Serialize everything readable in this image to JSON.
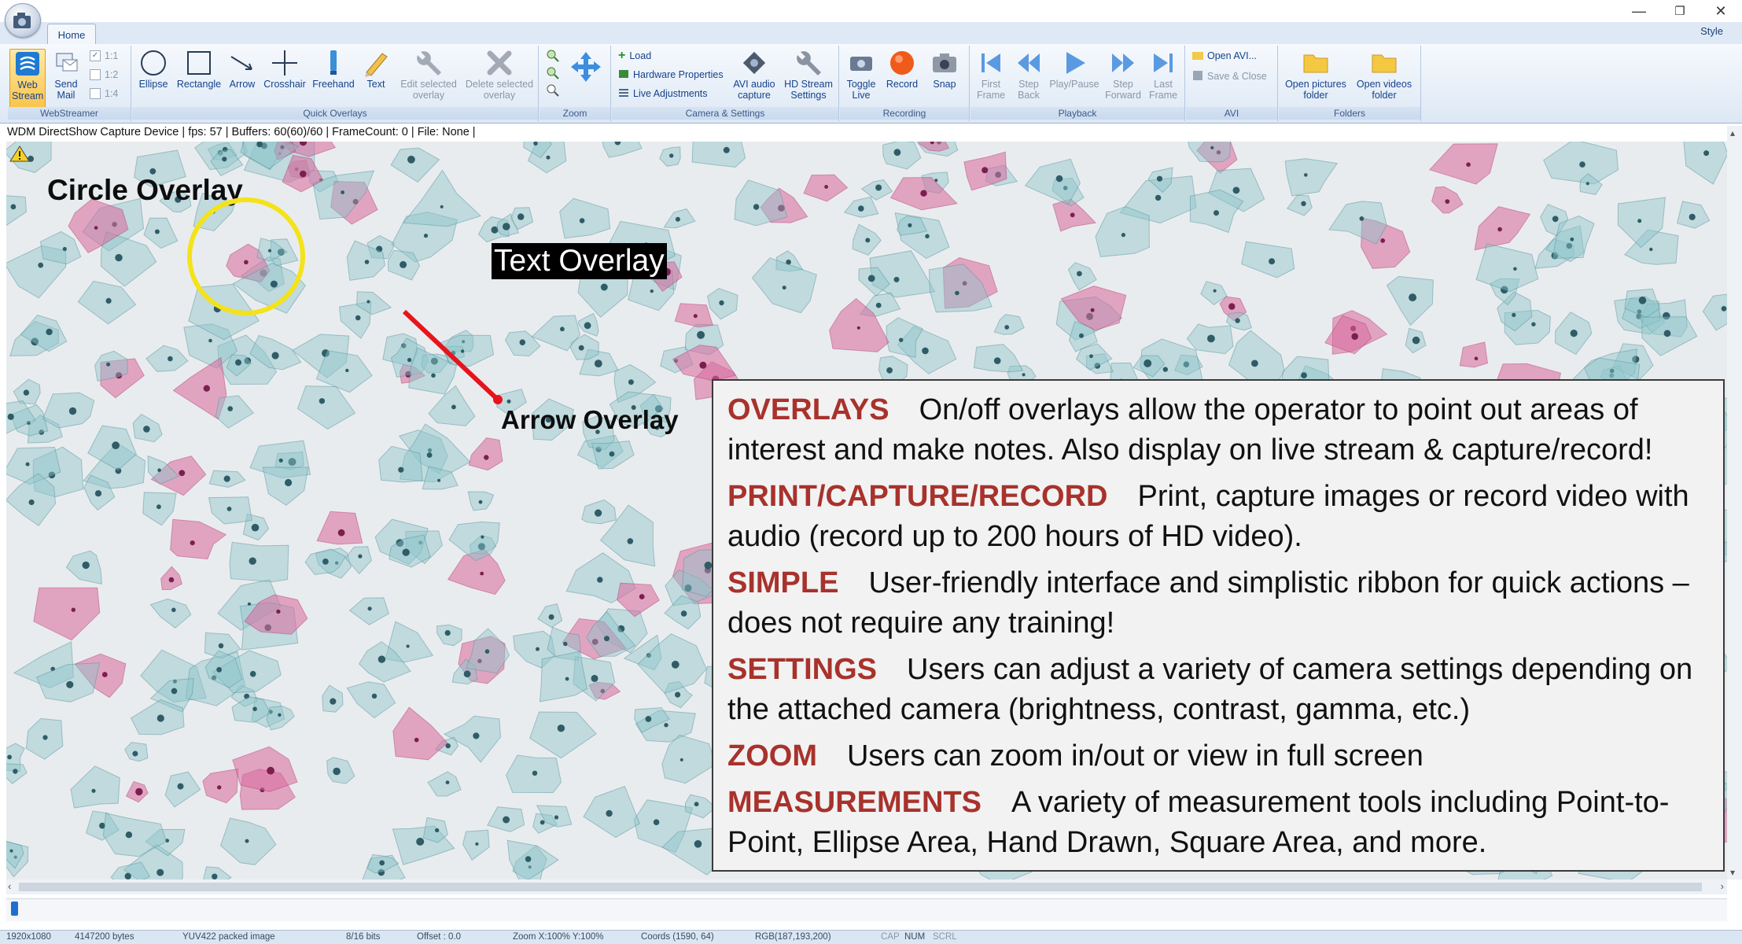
{
  "window": {
    "style_label": "Style",
    "controls": [
      "—",
      "❐",
      "✕"
    ]
  },
  "tabs": [
    {
      "label": "Home"
    }
  ],
  "ribbon": {
    "groups": {
      "webstreamer": "WebStreamer",
      "quick_overlays": "Quick Overlays",
      "zoom": "Zoom",
      "camera_settings": "Camera & Settings",
      "recording": "Recording",
      "playback": "Playback",
      "avi": "AVI",
      "folders": "Folders"
    },
    "webstreamer": {
      "web_stream": "Web Stream",
      "send_mail": "Send Mail",
      "ratio_1_1": "1:1",
      "ratio_1_2": "1:2",
      "ratio_1_4": "1:4"
    },
    "quick_overlays": {
      "ellipse": "Ellipse",
      "rectangle": "Rectangle",
      "arrow": "Arrow",
      "crosshair": "Crosshair",
      "freehand": "Freehand",
      "text": "Text",
      "edit_selected": "Edit selected overlay",
      "delete_selected": "Delete selected overlay"
    },
    "camera_settings": {
      "load": "Load",
      "hardware_properties": "Hardware Properties",
      "live_adjustments": "Live Adjustments",
      "avi_audio_capture": "AVI audio capture",
      "hd_stream_settings": "HD Stream Settings"
    },
    "recording": {
      "toggle_live": "Toggle Live",
      "record": "Record",
      "snap": "Snap"
    },
    "playback": {
      "first_frame": "First Frame",
      "step_back": "Step Back",
      "play_pause": "Play/Pause",
      "step_forward": "Step Forward",
      "last_frame": "Last Frame"
    },
    "avi": {
      "open_avi": "Open AVI...",
      "save_close": "Save & Close"
    },
    "folders": {
      "open_pictures": "Open pictures folder",
      "open_videos": "Open videos folder"
    }
  },
  "info_bar": "WDM DirectShow Capture Device | fps: 57 | Buffers: 60(60)/60 | FrameCount: 0 | File: None |",
  "overlays": {
    "circle_label": "Circle Overlay",
    "text_overlay": "Text Overlay",
    "arrow_label": "Arrow Overlay"
  },
  "panel": {
    "items": [
      {
        "keyword": "OVERLAYS",
        "text": "On/off overlays allow the operator to point out areas of interest and make notes. Also display on live stream & capture/record!"
      },
      {
        "keyword": "PRINT/CAPTURE/RECORD",
        "text": "Print, capture images or record video with audio (record up to 200 hours of HD video)."
      },
      {
        "keyword": "SIMPLE",
        "text": "User-friendly interface and simplistic ribbon for quick actions – does not require any training!"
      },
      {
        "keyword": "SETTINGS",
        "text": "Users can adjust a variety of camera settings depending on the attached camera (brightness, contrast, gamma, etc.)"
      },
      {
        "keyword": "ZOOM",
        "text": "Users can zoom in/out or view in full screen"
      },
      {
        "keyword": "MEASUREMENTS",
        "text": "A variety of measurement tools including Point-to-Point, Ellipse Area, Hand Drawn, Square Area, and more."
      }
    ]
  },
  "status_bar": {
    "resolution": "1920x1080",
    "bytes": "4147200 bytes",
    "format": "YUV422 packed image",
    "bits": "8/16 bits",
    "offset": "Offset : 0.0",
    "zoom": "Zoom X:100%  Y:100%",
    "coords": "Coords (1590, 64)",
    "rgb": "RGB(187,193,200)",
    "cap": "CAP",
    "num": "NUM",
    "scrl": "SCRL"
  },
  "colors": {
    "keyword": "#a8322c",
    "circle_overlay": "#f4e21a",
    "arrow_overlay": "#e8141b",
    "ribbon_text": "#15428b"
  }
}
